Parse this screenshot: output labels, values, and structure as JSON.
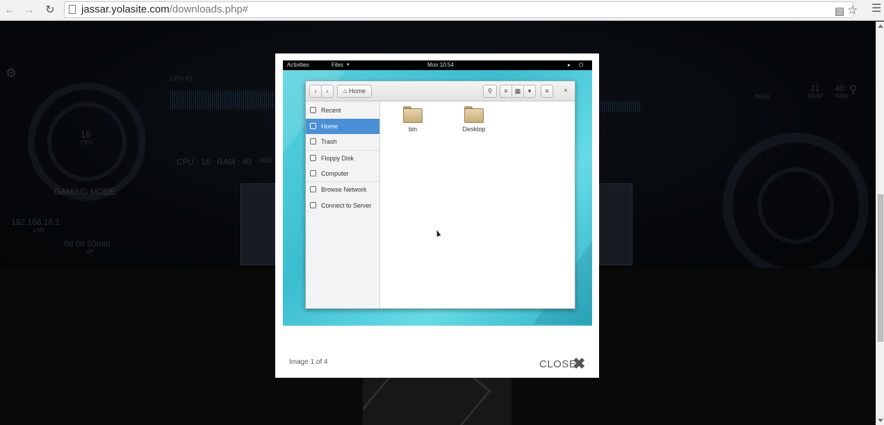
{
  "browser": {
    "url_host": "jassar.yolasite.com",
    "url_path": "/downloads.php#",
    "back_icon": "arrow-left",
    "forward_icon": "arrow-right",
    "reload_icon": "reload"
  },
  "background_page": {
    "hud": {
      "cpu_graph_label": "CPU #1",
      "circle_value": "16",
      "circle_unit": "CPU",
      "cpu_stat": "CPU : 16",
      "ram_stat": "RAM : 40",
      "hdd_stat": "HDD",
      "mode_label": "GAMING MODE",
      "ip_value": "192.168.16.1",
      "ip_label": "LAN",
      "uptime_value": "0d 0h 50mm",
      "uptime_label": "UP",
      "right_label": "WAN",
      "right_num_1": "21",
      "right_unit_1": "SWAP",
      "right_num_2": "40",
      "right_unit_2": "RAM"
    }
  },
  "lightbox": {
    "caption": "Image 1 of 4",
    "close_label": "CLOSE",
    "close_icon": "close-x",
    "screenshot": {
      "top_bar": {
        "activities": "Activities",
        "app_menu": "Files",
        "clock": "Mon 10:54"
      },
      "window": {
        "location": "Home",
        "close_glyph": "×",
        "sidebar": [
          {
            "label": "Recent",
            "selected": false
          },
          {
            "label": "Home",
            "selected": true
          },
          {
            "label": "Trash",
            "selected": false
          },
          {
            "label": "Floppy Disk",
            "selected": false
          },
          {
            "label": "Computer",
            "selected": false
          },
          {
            "label": "Browse Network",
            "selected": false
          },
          {
            "label": "Connect to Server",
            "selected": false
          }
        ],
        "files": [
          {
            "name": "bin"
          },
          {
            "name": "Desktop"
          }
        ]
      }
    }
  },
  "colors": {
    "selection": "#4a90d9",
    "desktop_teal": "#3bbdd0"
  }
}
